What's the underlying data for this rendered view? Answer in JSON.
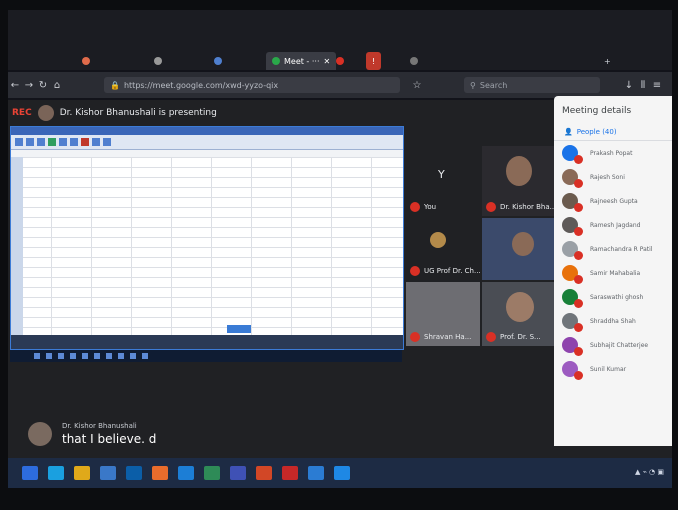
{
  "browser": {
    "tabs": [
      {
        "label": "Meet - ···",
        "active": true
      },
      {
        "label": "",
        "active": false,
        "highlight": "red"
      }
    ],
    "url": "https://meet.google.com/xwd-yyzo-qix",
    "search_placeholder": "Search"
  },
  "meet": {
    "rec_label": "REC",
    "presenting_text": "Dr. Kishor Bhanushali is presenting",
    "tiles": [
      {
        "label": "You",
        "letter": "Y"
      },
      {
        "label": "Dr. Kishor Bha..."
      },
      {
        "label": "UG Prof Dr. Ch..."
      },
      {
        "label": ""
      },
      {
        "label": "Shravan Ha..."
      },
      {
        "label": "Prof. Dr. S..."
      }
    ],
    "caption": {
      "speaker": "Dr. Kishor Bhanushali",
      "text": "that I believe. d"
    }
  },
  "panel": {
    "title": "Meeting details",
    "people_label": "People (40)",
    "participants": [
      {
        "name": "Prakash Popat",
        "color": "#1a73e8"
      },
      {
        "name": "Rajesh Soni",
        "color": "#8a6a57"
      },
      {
        "name": "Rajneesh Gupta",
        "color": "#6b5b4e"
      },
      {
        "name": "Ramesh Jagdand",
        "color": "#5e5a58"
      },
      {
        "name": "Ramachandra R Patil",
        "color": "#9aa0a6"
      },
      {
        "name": "Samir Mahabalia",
        "color": "#e8710a"
      },
      {
        "name": "Saraswathi ghosh",
        "color": "#188038"
      },
      {
        "name": "Shraddha Shah",
        "color": "#70757a"
      },
      {
        "name": "Subhajit Chatterjee",
        "color": "#8e44ad"
      },
      {
        "name": "Sunil Kumar",
        "color": "#9c5bc0"
      }
    ]
  },
  "colors": {
    "meet_bg": "#202124",
    "mic_off": "#d93025",
    "accent": "#1a73e8"
  }
}
